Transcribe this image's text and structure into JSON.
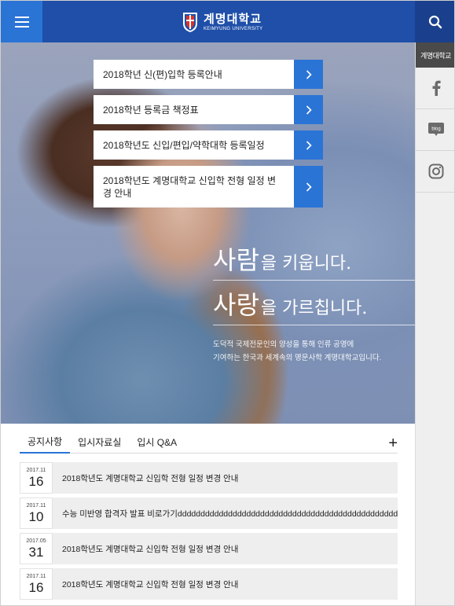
{
  "header": {
    "logo_kr": "계명대학교",
    "logo_en": "KEIMYUNG UNIVERSITY",
    "menu_icon": "hamburger-menu-icon",
    "search_icon": "search-icon"
  },
  "rail": {
    "label": "계명대학교",
    "items": [
      {
        "icon": "facebook-icon"
      },
      {
        "icon": "blog-icon",
        "text": "blog"
      },
      {
        "icon": "instagram-icon"
      }
    ]
  },
  "hero": {
    "links": [
      {
        "label": "2018학년 신(편)입학 등록안내"
      },
      {
        "label": "2018학년 등록금 책정표"
      },
      {
        "label": "2018학년도 신입/편입/약학대학 등록일정"
      },
      {
        "label": "2018학년도 계명대학교 신입학 전형 일정 변경 안내"
      }
    ],
    "slogan1_big": "사람",
    "slogan1_small": "을 키웁니다.",
    "slogan2_big": "사랑",
    "slogan2_small": "을 가르칩니다.",
    "desc_line1": "도덕적 국제전문인의 양성을 통해 인류 공영에",
    "desc_line2": "기여하는 한국과 세계속의 명문사학 계명대학교입니다."
  },
  "notice": {
    "tabs": [
      "공지사항",
      "입시자료실",
      "입시 Q&A"
    ],
    "more": "+",
    "items": [
      {
        "ym": "2017.11",
        "day": "16",
        "title": "2018학년도 계명대학교 신입학 전형 일정 변경 안내"
      },
      {
        "ym": "2017.11",
        "day": "10",
        "title": "수능 미반영 합격자 발표 비로가기dddddddddddddddddddddddddddddddddddddddddddddddd"
      },
      {
        "ym": "2017.05",
        "day": "31",
        "title": "2018학년도 계명대학교 신입학 전형 일정 변경 안내"
      },
      {
        "ym": "2017.11",
        "day": "16",
        "title": "2018학년도 계명대학교 신입학 전형 일정 변경 안내"
      }
    ]
  },
  "colors": {
    "header_bg": "#1f4fa8",
    "accent": "#2a74d6",
    "search_bg": "#1a3f8d"
  }
}
